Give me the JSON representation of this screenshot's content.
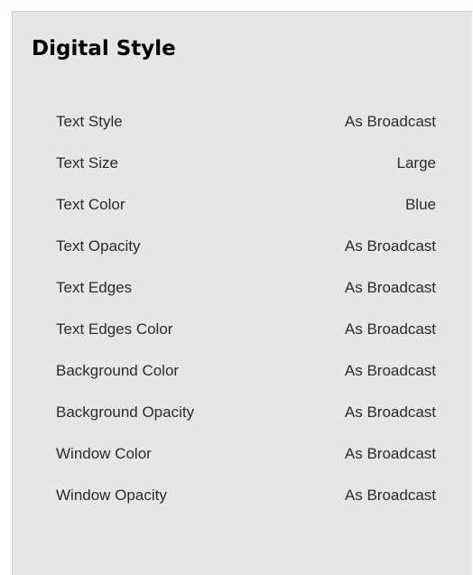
{
  "panel": {
    "title": "Digital Style",
    "settings": [
      {
        "label": "Text Style",
        "value": "As Broadcast"
      },
      {
        "label": "Text Size",
        "value": "Large"
      },
      {
        "label": "Text Color",
        "value": "Blue"
      },
      {
        "label": "Text Opacity",
        "value": "As Broadcast"
      },
      {
        "label": "Text Edges",
        "value": "As Broadcast"
      },
      {
        "label": "Text Edges Color",
        "value": "As Broadcast"
      },
      {
        "label": "Background Color",
        "value": "As Broadcast"
      },
      {
        "label": "Background Opacity",
        "value": "As Broadcast"
      },
      {
        "label": "Window Color",
        "value": "As Broadcast"
      },
      {
        "label": "Window Opacity",
        "value": "As Broadcast"
      }
    ]
  }
}
